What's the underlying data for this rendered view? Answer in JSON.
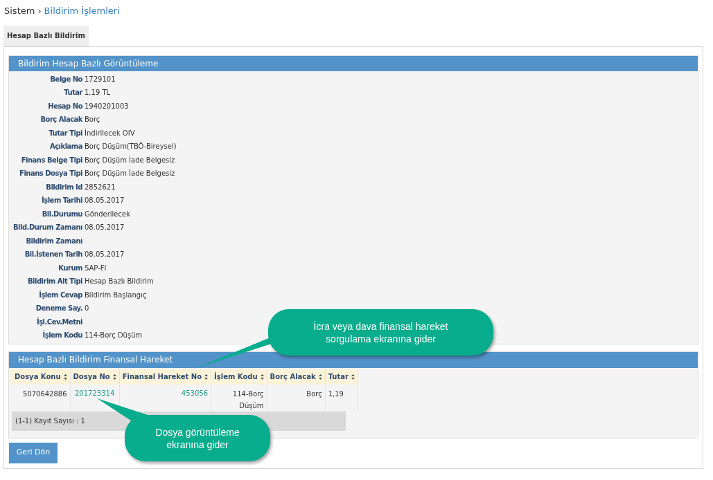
{
  "breadcrumb": {
    "root": "Sistem",
    "separator": "›",
    "current": "Bildirim İşlemleri"
  },
  "tabs": [
    {
      "label": "Hesap Bazlı Bildirim",
      "selected": true
    }
  ],
  "detail_panel": {
    "title": "Bildirim Hesap Bazlı Görüntüleme",
    "fields": [
      {
        "label": "Belge No",
        "value": "1729101"
      },
      {
        "label": "Tutar",
        "value": "1,19 TL"
      },
      {
        "label": "Hesap No",
        "value": "1940201003"
      },
      {
        "label": "Borç Alacak",
        "value": "Borç"
      },
      {
        "label": "Tutar Tipi",
        "value": "İndirilecek OIV"
      },
      {
        "label": "Açıklama",
        "value": "Borç Düşüm(TBÖ-Bireysel)"
      },
      {
        "label": "Finans Belge Tipi",
        "value": "Borç Düşüm İade Belgesiz"
      },
      {
        "label": "Finans Dosya Tipi",
        "value": "Borç Düşüm İade Belgesiz"
      },
      {
        "label": "Bildirim Id",
        "value": "2852621"
      },
      {
        "label": "İşlem Tarihi",
        "value": "08.05.2017"
      },
      {
        "label": "Bil.Durumu",
        "value": "Gönderilecek"
      },
      {
        "label": "Bild.Durum Zamanı",
        "value": "08.05.2017"
      },
      {
        "label": "Bildirim Zamanı"
      },
      {
        "label": "Bil.İstenen Tarih",
        "value": "08.05.2017"
      },
      {
        "label": "Kurum",
        "value": "SAP-FI"
      },
      {
        "label": "Bildirim Alt Tipi",
        "value": "Hesap Bazlı Bildirim"
      },
      {
        "label": "İşlem Cevap",
        "value": "Bildirim Başlangıç"
      },
      {
        "label": "Deneme Say.",
        "value": "0"
      },
      {
        "label": "İşl.Cev.Metni"
      },
      {
        "label": "İşlem Kodu",
        "value": "114-Borç Düşüm"
      }
    ]
  },
  "table_panel": {
    "title": "Hesap Bazlı Bildirim Finansal Hareket",
    "table": {
      "columns": [
        "Dosya Konu",
        "Dosya No",
        "Finansal Hareket No",
        "İşlem Kodu",
        "Borç Alacak",
        "Tutar"
      ],
      "rows": [
        [
          {
            "text": "5070642886",
            "kind": "text"
          },
          {
            "text": "201723314",
            "kind": "link"
          },
          {
            "text": "453056",
            "kind": "link"
          },
          {
            "text": "114-Borç Düşüm",
            "kind": "text"
          },
          {
            "text": "Borç",
            "kind": "text"
          },
          {
            "text": "1,19",
            "kind": "text"
          }
        ]
      ],
      "footer": "(1-1) Kayıt Sayısı : 1"
    }
  },
  "buttons": [
    "Geri Dön"
  ],
  "callouts": [
    "İcra veya dava finansal hareket sorgulama ekranına gider",
    "Dosya görüntüleme ekranına gider"
  ]
}
